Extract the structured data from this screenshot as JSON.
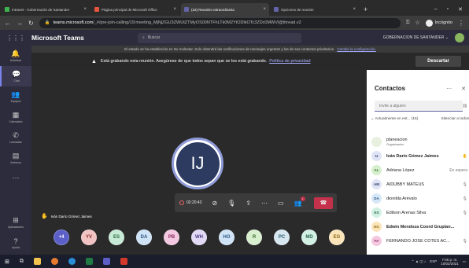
{
  "browser": {
    "tabs": [
      {
        "label": "Intranet - Gobernación de Santander",
        "color": "#3fb34f"
      },
      {
        "label": "Página principal de Microsoft Office",
        "color": "#e8553e"
      },
      {
        "label": "(22) Reunión extraordinaria",
        "color": "#6264a7",
        "active": true
      },
      {
        "label": "Opciones de reunión",
        "color": "#6264a7"
      }
    ],
    "url_domain": "teams.microsoft.com",
    "url_path": "/_#/pre-join-calling/19:meeting_MjNjZGU3ZWUtZTMyOS00NTFhLTk0M2YtODlkOTc3ZDc0MWVl@thread.v2",
    "incognito_label": "Incógnito"
  },
  "teams": {
    "brand": "Microsoft Teams",
    "search_placeholder": "Buscar",
    "org": "GOBERNACION DE SANTANDER"
  },
  "rail": [
    {
      "label": "Actividad",
      "icon": "bell-icon",
      "glyph": "🔔"
    },
    {
      "label": "Chat",
      "icon": "chat-icon",
      "glyph": "💬",
      "active": true
    },
    {
      "label": "Equipos",
      "icon": "teams-icon",
      "glyph": "👥"
    },
    {
      "label": "Calendario",
      "icon": "calendar-icon",
      "glyph": "▦"
    },
    {
      "label": "Llamadas",
      "icon": "phone-icon",
      "glyph": "✆"
    },
    {
      "label": "Archivos",
      "icon": "files-icon",
      "glyph": "▤"
    },
    {
      "label": "",
      "icon": "more-icon",
      "glyph": "⋯"
    }
  ],
  "rail_bottom": [
    {
      "label": "Aplicaciones",
      "icon": "apps-icon",
      "glyph": "⊞"
    },
    {
      "label": "Ayuda",
      "icon": "help-icon",
      "glyph": "?"
    }
  ],
  "banner": {
    "text": "El estado se ha establecido en No molestar. Solo obtendrá las notificaciones de mensajes urgentes y las de sus contactos prioritarios.",
    "link": "Cambie la configuración."
  },
  "recording": {
    "bold": "Está grabando",
    "text": "Está grabando esta reunión. Asegúrese de que todos sepan que se les está grabando.",
    "link": "Política de privacidad",
    "dismiss": "Descartar"
  },
  "stage": {
    "initials": "IJ",
    "speaker": "Iván Darío Gómez Jaimes",
    "timer": "02:20:43",
    "participant_badge": "1"
  },
  "strip": [
    {
      "label": "+4",
      "bg": "#5b5fc7",
      "fg": "#ffffff"
    },
    {
      "label": "YV",
      "bg": "#f2c3c3",
      "fg": "#8a2b2b"
    },
    {
      "label": "ES",
      "bg": "#c6ead5",
      "fg": "#2d6a44"
    },
    {
      "label": "DA",
      "bg": "#cfe3f7",
      "fg": "#2a5480"
    },
    {
      "label": "PB",
      "bg": "#f4c8e0",
      "fg": "#8a2a5e"
    },
    {
      "label": "WH",
      "bg": "#e2d9f5",
      "fg": "#4d3a80"
    },
    {
      "label": "HO",
      "bg": "#cfe3f7",
      "fg": "#2a5480"
    },
    {
      "label": "R",
      "bg": "#d8efce",
      "fg": "#3c6a2d"
    },
    {
      "label": "PC",
      "bg": "#d6e7f0",
      "fg": "#2d5a70"
    },
    {
      "label": "MD",
      "bg": "#d2f0e3",
      "fg": "#2d6a55"
    },
    {
      "label": "EG",
      "bg": "#fbe5b8",
      "fg": "#8a6414"
    }
  ],
  "contacts": {
    "title": "Contactos",
    "invite_placeholder": "Invite a alguien",
    "group_label": "Actualmente en est...",
    "group_count": "(16)",
    "mute_all": "Silenciar a todos",
    "people": [
      {
        "name": "planeacion",
        "sub": "Organizador",
        "initials": "",
        "bg": "#e8f1e0",
        "fg": "#3c6a2d",
        "side": ""
      },
      {
        "name": "Iván Darío Gómez Jaimes",
        "sub": "",
        "initials": "IJ",
        "bg": "#dfe3f6",
        "fg": "#2d3b60",
        "side": "✋",
        "bold": true
      },
      {
        "name": "Adriana López",
        "sub": "",
        "initials": "AL",
        "bg": "#d6efcd",
        "fg": "#3c6a2d",
        "side": "En espera"
      },
      {
        "name": "AIDUBBY MATEUS",
        "sub": "",
        "initials": "AM",
        "bg": "#dfe3f6",
        "fg": "#2d3b60",
        "side": "🎙"
      },
      {
        "name": "dionilda Arévalo",
        "sub": "",
        "initials": "DA",
        "bg": "#d6e7f7",
        "fg": "#2a5480",
        "side": "🎙"
      },
      {
        "name": "Edilson Arenas Silva",
        "sub": "",
        "initials": "ES",
        "bg": "#d2f0e3",
        "fg": "#2d6a55",
        "side": "🎙"
      },
      {
        "name": "Edwin Mendoza Coord Gruplan...",
        "sub": "",
        "initials": "EG",
        "bg": "#fbe5b8",
        "fg": "#8a6414",
        "side": "",
        "bold": true
      },
      {
        "name": "FERNANDO JOSE COTES AC...",
        "sub": "",
        "initials": "FA",
        "bg": "#f4c8e0",
        "fg": "#8a2a5e",
        "side": "🎙"
      }
    ]
  },
  "taskbar": {
    "lang": "ESP",
    "time": "7:06 p. m.",
    "date": "10/02/2021"
  }
}
